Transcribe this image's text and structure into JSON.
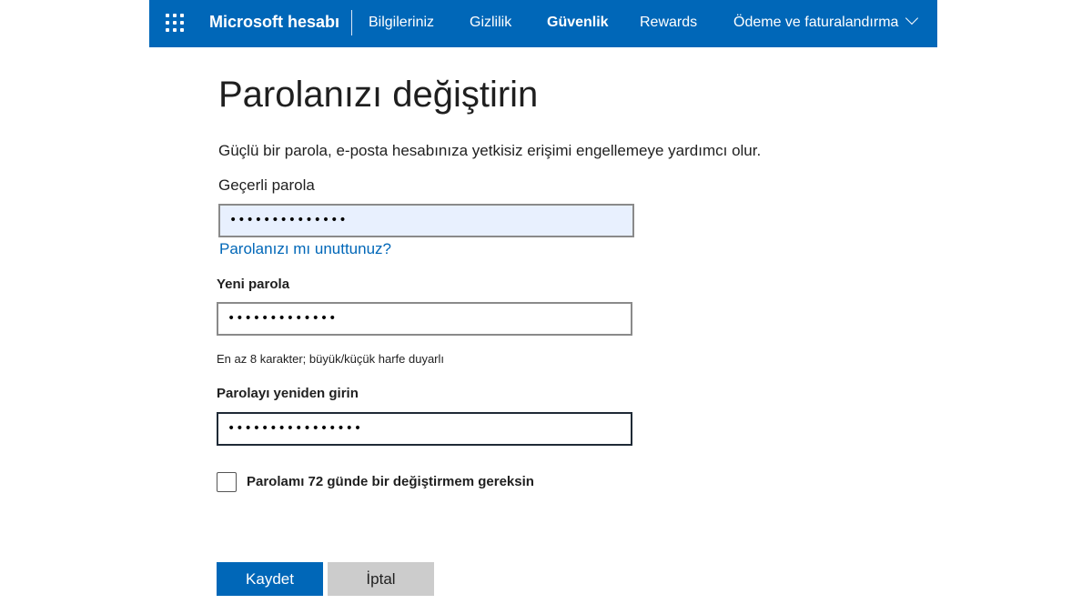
{
  "header": {
    "brand": "Microsoft hesabı",
    "nav": [
      {
        "label": "Bilgileriniz",
        "active": false
      },
      {
        "label": "Gizlilik",
        "active": false
      },
      {
        "label": "Güvenlik",
        "active": true
      },
      {
        "label": "Rewards",
        "active": false
      },
      {
        "label": "Ödeme ve faturalandırma",
        "active": false
      }
    ],
    "accent_color": "#0067b8"
  },
  "page": {
    "title": "Parolanızı değiştirin",
    "description": "Güçlü bir parola, e-posta hesabınıza yetkisiz erişimi engellemeye yardımcı olur."
  },
  "form": {
    "current_password": {
      "label": "Geçerli parola",
      "value": "••••••••••••••"
    },
    "forgot_link": "Parolanızı mı unuttunuz?",
    "new_password": {
      "label": "Yeni parola",
      "value": "•••••••••••••",
      "hint": "En az 8 karakter; büyük/küçük harfe duyarlı"
    },
    "confirm_password": {
      "label": "Parolayı yeniden girin",
      "value": "••••••••••••••••"
    },
    "expire_checkbox": {
      "label": "Parolamı 72 günde bir değiştirmem gereksin",
      "checked": false
    },
    "save_label": "Kaydet",
    "cancel_label": "İptal"
  }
}
